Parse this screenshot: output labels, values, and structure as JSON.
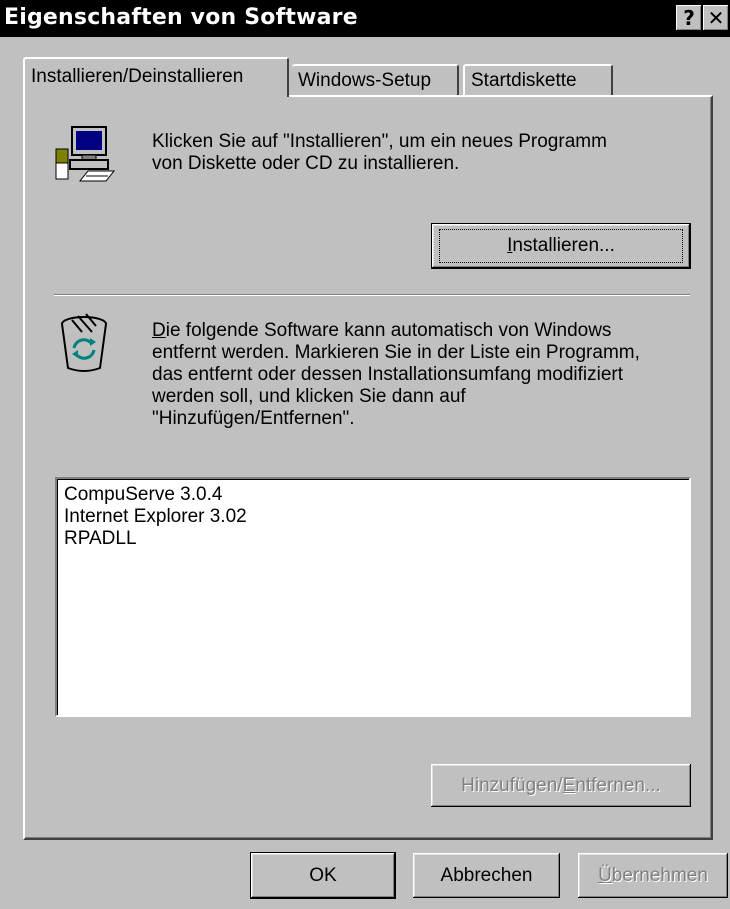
{
  "window": {
    "title": "Eigenschaften von Software",
    "help_button": "?",
    "close_button": "✕"
  },
  "tabs": [
    {
      "label": "Installieren/Deinstallieren",
      "active": true
    },
    {
      "label": "Windows-Setup",
      "active": false
    },
    {
      "label": "Startdiskette",
      "active": false
    }
  ],
  "install": {
    "icon": "computer-install-icon",
    "text_line1": "Klicken Sie auf \"Installieren\", um ein neues Programm",
    "text_line2": "von Diskette oder CD zu installieren.",
    "button_label_mnemonic": "I",
    "button_label_rest": "nstallieren..."
  },
  "uninstall": {
    "icon": "recycle-bin-icon",
    "text_line1_mnemonic": "D",
    "text_line1_rest": "ie folgende Software kann automatisch von Windows",
    "text_line2": "entfernt werden. Markieren Sie in der Liste ein Programm,",
    "text_line3": "das entfernt oder dessen Installationsumfang modifiziert",
    "text_line4": "werden soll, und klicken Sie dann auf",
    "text_line5": "\"Hinzufügen/Entfernen\".",
    "programs": [
      "CompuServe 3.0.4",
      "Internet Explorer 3.02",
      "RPADLL"
    ],
    "add_remove_part1": "Hinzufügen/",
    "add_remove_mnemonic": "E",
    "add_remove_part2": "ntfernen..."
  },
  "footer": {
    "ok_label": "OK",
    "cancel_label": "Abbrechen",
    "apply_mnemonic": "Ü",
    "apply_rest": "bernehmen"
  }
}
